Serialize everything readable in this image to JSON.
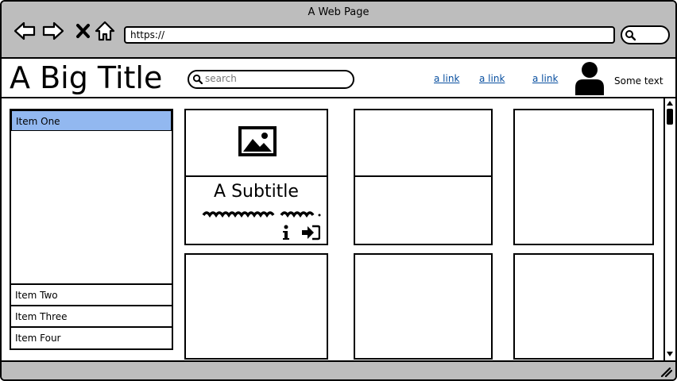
{
  "window": {
    "title": "A Web Page"
  },
  "browser": {
    "url": "https://"
  },
  "header": {
    "title": "A Big Title",
    "search_placeholder": "search",
    "links": [
      "a link",
      "a link",
      "a link"
    ],
    "user_text": "Some text"
  },
  "sidebar": {
    "items": [
      {
        "label": "Item One",
        "selected": true
      },
      {
        "label": "Item Two",
        "selected": false
      },
      {
        "label": "Item Three",
        "selected": false
      },
      {
        "label": "Item Four",
        "selected": false
      }
    ]
  },
  "cards": {
    "featured": {
      "subtitle": "A Subtitle",
      "icons": [
        "image-icon",
        "info-icon",
        "sign-in-icon"
      ]
    }
  },
  "colors": {
    "chrome": "#bdbdbd",
    "selected": "#92b8f0",
    "link": "#0a50a0"
  }
}
